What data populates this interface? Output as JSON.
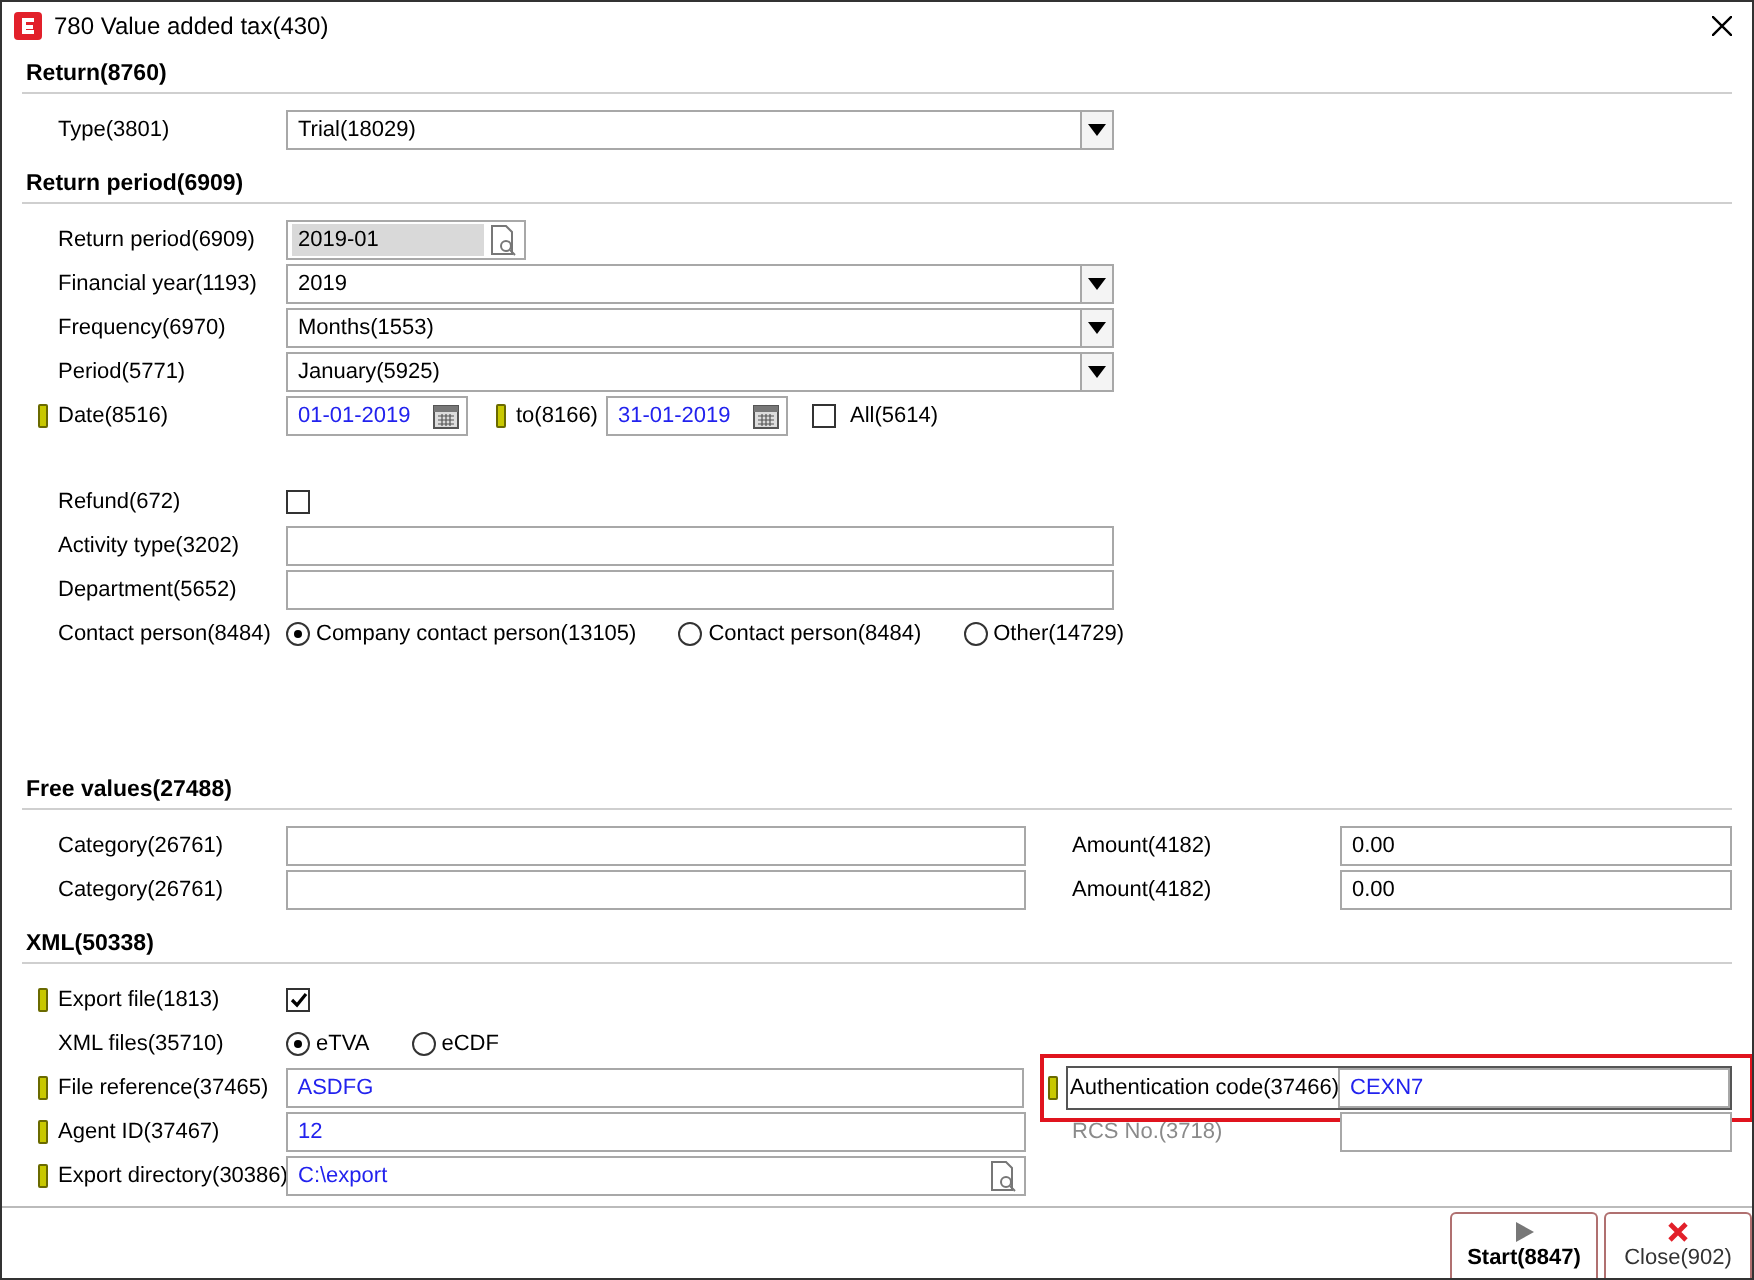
{
  "window": {
    "title": "780 Value added tax(430)"
  },
  "sections": [
    {
      "title": "Return(8760)",
      "groups": [
        [
          {
            "kind": "select",
            "label": "Type(3801)",
            "value": "Trial(18029)",
            "required": false
          }
        ]
      ]
    },
    {
      "title": "Return period(6909)",
      "groups": [
        [
          {
            "kind": "lookup",
            "label": "Return period(6909)",
            "value": "2019-01",
            "readonly": true,
            "required": false,
            "entered": false
          },
          {
            "kind": "select",
            "label": "Financial year(1193)",
            "value": "2019",
            "required": false
          },
          {
            "kind": "select",
            "label": "Frequency(6970)",
            "value": "Months(1553)",
            "required": false
          },
          {
            "kind": "select",
            "label": "Period(5771)",
            "value": "January(5925)",
            "required": false
          },
          {
            "kind": "daterange",
            "label": "Date(8516)",
            "required": true,
            "from": "01-01-2019",
            "to_label": "to(8166)",
            "to": "31-01-2019",
            "all_label": "All(5614)",
            "all_checked": false
          }
        ],
        [
          {
            "kind": "checkbox",
            "label": "Refund(672)",
            "checked": false,
            "required": false
          },
          {
            "kind": "text",
            "label": "Activity type(3202)",
            "required": false
          },
          {
            "kind": "text",
            "label": "Department(5652)",
            "required": false
          },
          {
            "kind": "radio",
            "label": "Contact person(8484)",
            "required": false,
            "options": [
              {
                "label": "Company contact person(13105)",
                "selected": true
              },
              {
                "label": "Contact person(8484)",
                "selected": false
              },
              {
                "label": "Other(14729)",
                "selected": false
              }
            ]
          }
        ]
      ]
    },
    {
      "title": "Free values(27488)",
      "groups": [
        [
          {
            "kind": "pair",
            "label": "Category(26761)",
            "required": false,
            "right": {
              "label": "Amount(4182)",
              "value": "0.00",
              "required": false,
              "disabled": false,
              "highlighted": false,
              "entered": false
            }
          },
          {
            "kind": "pair",
            "label": "Category(26761)",
            "required": false,
            "right": {
              "label": "Amount(4182)",
              "value": "0.00",
              "required": false,
              "disabled": false,
              "highlighted": false,
              "entered": false
            }
          }
        ]
      ]
    },
    {
      "title": "XML(50338)",
      "groups": [
        [
          {
            "kind": "checkbox",
            "label": "Export file(1813)",
            "checked": true,
            "required": true
          },
          {
            "kind": "radio",
            "label": "XML files(35710)",
            "required": false,
            "options": [
              {
                "label": "eTVA",
                "selected": true
              },
              {
                "label": "eCDF",
                "selected": false
              }
            ]
          },
          {
            "kind": "pair",
            "label": "File reference(37465)",
            "value": "ASDFG",
            "required": true,
            "entered": true,
            "right": {
              "label": "Authentication code(37466)",
              "value": "CEXN7",
              "required": true,
              "disabled": false,
              "highlighted": true,
              "entered": true
            }
          },
          {
            "kind": "pair",
            "label": "Agent ID(37467)",
            "value": "12",
            "required": true,
            "entered": true,
            "right": {
              "label": "RCS No.(3718)",
              "required": false,
              "disabled": true,
              "highlighted": false
            }
          },
          {
            "kind": "lookup",
            "label": "Export directory(30386)",
            "value": "C:\\export",
            "readonly": false,
            "required": true,
            "entered": true
          }
        ]
      ]
    }
  ],
  "buttons": [
    {
      "kind": "start",
      "label": "Start(8847)"
    },
    {
      "kind": "close",
      "label": "Close(902)"
    }
  ]
}
